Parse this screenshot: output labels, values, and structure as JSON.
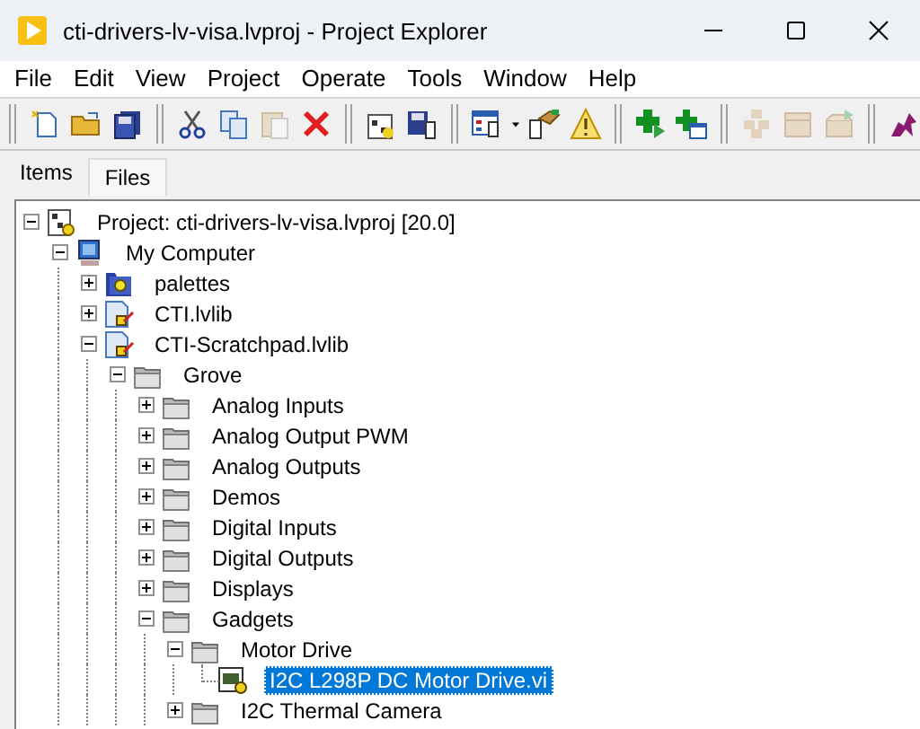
{
  "window": {
    "title": "cti-drivers-lv-visa.lvproj - Project Explorer"
  },
  "menu": [
    "File",
    "Edit",
    "View",
    "Project",
    "Operate",
    "Tools",
    "Window",
    "Help"
  ],
  "toolbar": [
    {
      "kind": "new",
      "disabled": false
    },
    {
      "kind": "open",
      "disabled": false
    },
    {
      "kind": "save-all",
      "disabled": false
    },
    {
      "kind": "sep"
    },
    {
      "kind": "cut",
      "disabled": false
    },
    {
      "kind": "copy",
      "disabled": false
    },
    {
      "kind": "paste",
      "disabled": true
    },
    {
      "kind": "delete",
      "disabled": false
    },
    {
      "kind": "sep"
    },
    {
      "kind": "build",
      "disabled": false
    },
    {
      "kind": "save-project",
      "disabled": false
    },
    {
      "kind": "sep"
    },
    {
      "kind": "view",
      "disabled": false
    },
    {
      "kind": "dropdown",
      "disabled": false
    },
    {
      "kind": "deploy",
      "disabled": false
    },
    {
      "kind": "warning",
      "disabled": false
    },
    {
      "kind": "sep"
    },
    {
      "kind": "add",
      "disabled": false
    },
    {
      "kind": "add-window",
      "disabled": false
    },
    {
      "kind": "sep"
    },
    {
      "kind": "boxes",
      "disabled": true
    },
    {
      "kind": "box",
      "disabled": true
    },
    {
      "kind": "box-open",
      "disabled": true
    },
    {
      "kind": "sep"
    },
    {
      "kind": "dragon",
      "disabled": false
    }
  ],
  "tabs": [
    {
      "label": "Items",
      "selected": true
    },
    {
      "label": "Files",
      "selected": false
    }
  ],
  "tree": [
    {
      "label": "Project: cti-drivers-lv-visa.lvproj [20.0]",
      "kind": "project",
      "expanded": true,
      "selected": false,
      "children": [
        {
          "label": "My Computer",
          "kind": "computer",
          "expanded": true,
          "selected": false,
          "children": [
            {
              "label": "palettes",
              "kind": "palette",
              "expanded": false,
              "selected": false
            },
            {
              "label": "CTI.lvlib",
              "kind": "library",
              "expanded": false,
              "selected": false
            },
            {
              "label": "CTI-Scratchpad.lvlib",
              "kind": "library",
              "expanded": true,
              "selected": false,
              "children": [
                {
                  "label": "Grove",
                  "kind": "folder",
                  "expanded": true,
                  "selected": false,
                  "children": [
                    {
                      "label": "Analog Inputs",
                      "kind": "folder",
                      "expanded": false,
                      "selected": false
                    },
                    {
                      "label": "Analog Output PWM",
                      "kind": "folder",
                      "expanded": false,
                      "selected": false
                    },
                    {
                      "label": "Analog Outputs",
                      "kind": "folder",
                      "expanded": false,
                      "selected": false
                    },
                    {
                      "label": "Demos",
                      "kind": "folder",
                      "expanded": false,
                      "selected": false
                    },
                    {
                      "label": "Digital Inputs",
                      "kind": "folder",
                      "expanded": false,
                      "selected": false
                    },
                    {
                      "label": "Digital Outputs",
                      "kind": "folder",
                      "expanded": false,
                      "selected": false
                    },
                    {
                      "label": "Displays",
                      "kind": "folder",
                      "expanded": false,
                      "selected": false
                    },
                    {
                      "label": "Gadgets",
                      "kind": "folder",
                      "expanded": true,
                      "selected": false,
                      "children": [
                        {
                          "label": "Motor Drive",
                          "kind": "folder",
                          "expanded": true,
                          "selected": false,
                          "children": [
                            {
                              "label": "I2C L298P DC Motor Drive.vi",
                              "kind": "vi",
                              "selected": true
                            }
                          ]
                        },
                        {
                          "label": "I2C Thermal Camera",
                          "kind": "folder",
                          "expanded": false,
                          "selected": false
                        }
                      ]
                    }
                  ]
                }
              ]
            }
          ]
        }
      ]
    }
  ]
}
